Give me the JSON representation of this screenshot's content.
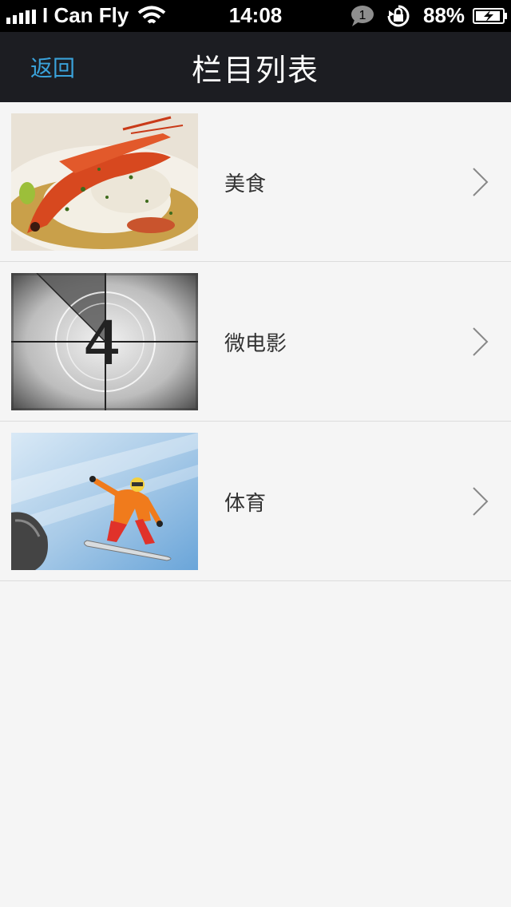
{
  "status_bar": {
    "carrier": "I Can Fly",
    "time": "14:08",
    "notification_count": "1",
    "battery_percent": "88%"
  },
  "nav": {
    "back_label": "返回",
    "title": "栏目列表"
  },
  "list": [
    {
      "label": "美食",
      "image": "food-dish-image"
    },
    {
      "label": "微电影",
      "image": "film-countdown-image"
    },
    {
      "label": "体育",
      "image": "snowboarder-image"
    }
  ],
  "film_countdown_number": "4"
}
